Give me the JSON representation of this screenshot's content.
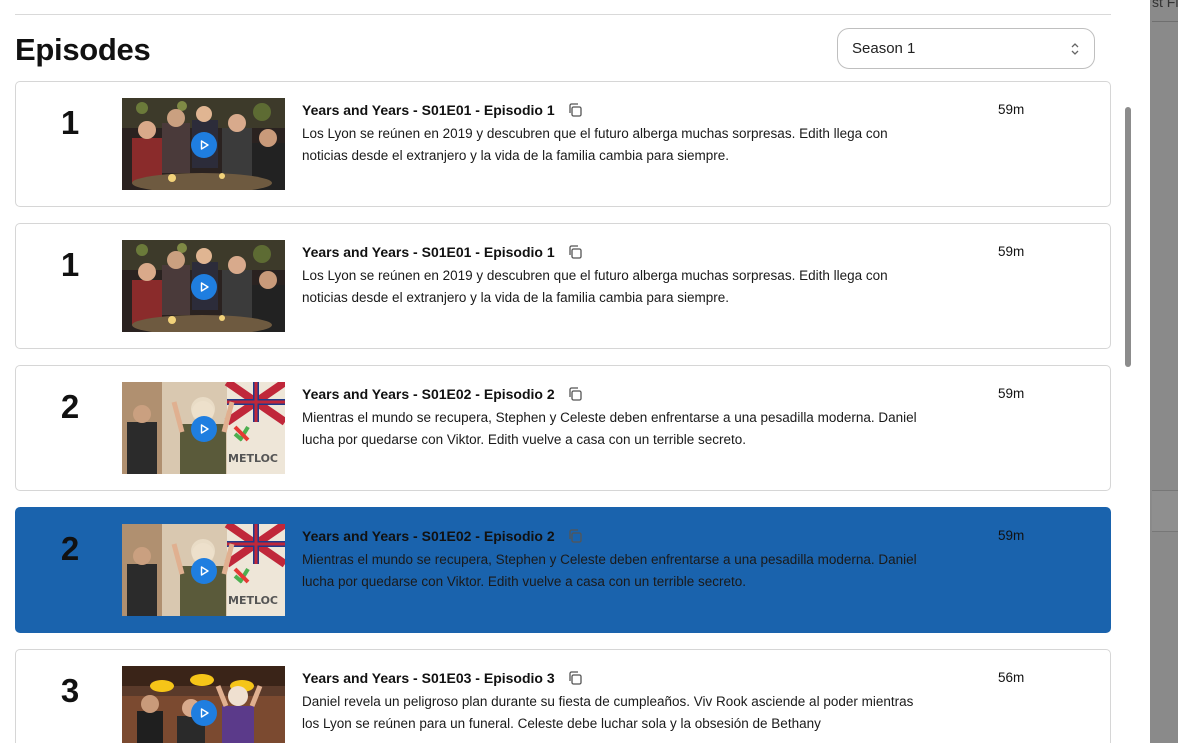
{
  "backdrop": {
    "text": "st Fi"
  },
  "header": {
    "title": "Episodes"
  },
  "season_select": {
    "value": "Season 1"
  },
  "episodes": [
    {
      "number": "1",
      "title": "Years and Years - S01E01 - Episodio 1",
      "description": "Los Lyon se reúnen en 2019 y descubren que el futuro alberga muchas sorpresas. Edith llega con noticias desde el extranjero y la vida de la familia cambia para siempre.",
      "duration": "59m",
      "selected": false
    },
    {
      "number": "1",
      "title": "Years and Years - S01E01 - Episodio 1",
      "description": "Los Lyon se reúnen en 2019 y descubren que el futuro alberga muchas sorpresas. Edith llega con noticias desde el extranjero y la vida de la familia cambia para siempre.",
      "duration": "59m",
      "selected": false
    },
    {
      "number": "2",
      "title": "Years and Years - S01E02 - Episodio 2",
      "description": "Mientras el mundo se recupera, Stephen y Celeste deben enfrentarse a una pesadilla moderna. Daniel lucha por quedarse con Viktor. Edith vuelve a casa con un terrible secreto.",
      "duration": "59m",
      "selected": false
    },
    {
      "number": "2",
      "title": "Years and Years - S01E02 - Episodio 2",
      "description": "Mientras el mundo se recupera, Stephen y Celeste deben enfrentarse a una pesadilla moderna. Daniel lucha por quedarse con Viktor. Edith vuelve a casa con un terrible secreto.",
      "duration": "59m",
      "selected": true
    },
    {
      "number": "3",
      "title": "Years and Years - S01E03 - Episodio 3",
      "description": "Daniel revela un peligroso plan durante su fiesta de cumpleaños. Viv Rook asciende al poder mientras los Lyon se reúnen para un funeral. Celeste debe luchar sola y la obsesión de Bethany",
      "duration": "56m",
      "selected": false
    }
  ],
  "thumb_logo_text": "METLOC",
  "colors": {
    "selected_row": "#1a63ad",
    "play_button": "#1f7ee0"
  }
}
